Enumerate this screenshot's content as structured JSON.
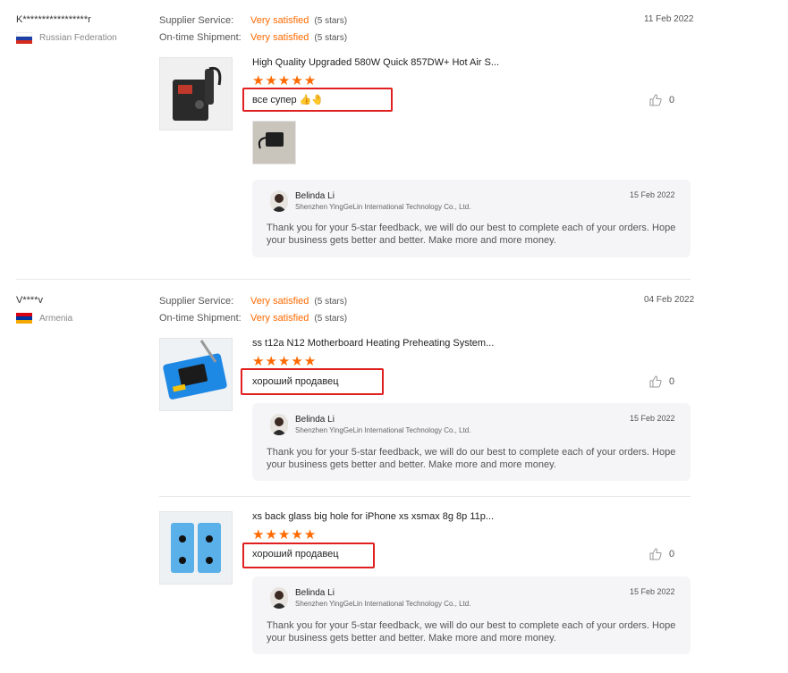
{
  "reviews": [
    {
      "buyer": "K*****************r",
      "country": "Russian Federation",
      "flag_colors": [
        "#ffffff",
        "#1c3fa8",
        "#d52b1e"
      ],
      "supplier_service_label": "Supplier Service:",
      "supplier_service_value": "Very satisfied",
      "supplier_service_note": "(5 stars)",
      "shipment_label": "On-time Shipment:",
      "shipment_value": "Very satisfied",
      "shipment_note": "(5 stars)",
      "date": "11 Feb 2022",
      "items": [
        {
          "title": "High Quality Upgraded 580W Quick 857DW+ Hot Air S...",
          "rating": 5,
          "comment": "все супер 👍🤚",
          "likes": "0",
          "has_photo": true,
          "reply": {
            "name": "Belinda Li",
            "company": "Shenzhen YingGeLin International Technology Co., Ltd.",
            "date": "15 Feb 2022",
            "text": "Thank you for your 5-star feedback, we will do our best to complete each of your orders. Hope your business gets better and better. Make more and more money."
          }
        }
      ]
    },
    {
      "buyer": "V****v",
      "country": "Armenia",
      "flag_colors": [
        "#d90012",
        "#0033a0",
        "#f2a800"
      ],
      "supplier_service_label": "Supplier Service:",
      "supplier_service_value": "Very satisfied",
      "supplier_service_note": "(5 stars)",
      "shipment_label": "On-time Shipment:",
      "shipment_value": "Very satisfied",
      "shipment_note": "(5 stars)",
      "date": "04 Feb 2022",
      "items": [
        {
          "title": "ss t12a N12 Motherboard Heating Preheating System...",
          "rating": 5,
          "comment": "хороший продавец",
          "likes": "0",
          "reply": {
            "name": "Belinda Li",
            "company": "Shenzhen YingGeLin International Technology Co., Ltd.",
            "date": "15 Feb 2022",
            "text": "Thank you for your 5-star feedback, we will do our best to complete each of your orders. Hope your business gets better and better. Make more and more money."
          }
        },
        {
          "title": "xs back glass big hole for iPhone xs xsmax 8g 8p 11p...",
          "rating": 5,
          "comment": "хороший продавец",
          "likes": "0",
          "reply": {
            "name": "Belinda Li",
            "company": "Shenzhen YingGeLin International Technology Co., Ltd.",
            "date": "15 Feb 2022",
            "text": "Thank you for your 5-star feedback, we will do our best to complete each of your orders. Hope your business gets better and better. Make more and more money."
          }
        }
      ]
    }
  ],
  "icons": {
    "star": "star-icon",
    "like": "thumbs-up-icon"
  },
  "accent_color": "#ff6a00",
  "highlight_color": "#e02020"
}
